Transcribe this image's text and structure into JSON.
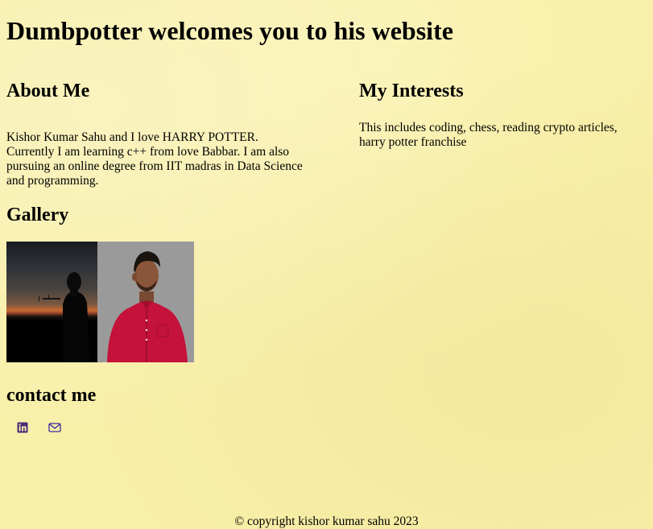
{
  "page": {
    "title": "Dumbpotter welcomes you to his website"
  },
  "about": {
    "heading": "About Me",
    "text": "Kishor Kumar Sahu and I love HARRY POTTER. Currently I am learning c++ from love Babbar. I am also pursuing an online degree from IIT madras in Data Science and programming."
  },
  "interests": {
    "heading": "My Interests",
    "text": "This includes coding, chess, reading crypto articles, harry potter franchise"
  },
  "gallery": {
    "heading": "Gallery",
    "images": [
      {
        "name": "sunset-silhouette-photo"
      },
      {
        "name": "portrait-photo"
      }
    ]
  },
  "contact": {
    "heading": "contact me",
    "links": [
      {
        "icon": "linkedin-icon",
        "color": "#4b2a7b"
      },
      {
        "icon": "mail-icon",
        "color": "#3a2a9b"
      }
    ]
  },
  "footer": {
    "text": "© copyright kishor kumar sahu 2023"
  },
  "colors": {
    "background": "#f8efa9",
    "text": "#000000"
  }
}
